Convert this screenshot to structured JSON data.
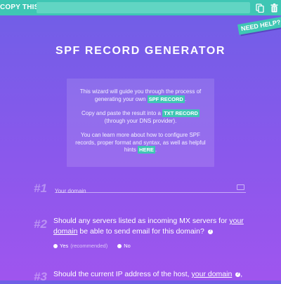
{
  "copy_bar": {
    "label": "COPY THIS:",
    "value": "",
    "copy_icon": "copy-icon",
    "delete_icon": "trash-icon",
    "accent": "#3fc6b4"
  },
  "need_help": "NEED HELP?",
  "title": "SPF RECORD GENERATOR",
  "intro": {
    "line1_pre": "This wizard will guide you through the process of generating your own",
    "line1_badge": "SPF RECORD",
    "line1_post": ".",
    "line2_pre": "Copy and paste the result into a",
    "line2_badge": "TXT RECORD",
    "line2_post": "(through your DNS provider).",
    "line3_pre": "You can learn more about how to configure SPF records, proper format and syntax, as well as helpful hints",
    "line3_badge": "HERE",
    "line3_post": "."
  },
  "step1": {
    "number": "#1",
    "placeholder": "Your domain",
    "value": ""
  },
  "step2": {
    "number": "#2",
    "q_pre": "Should any servers listed as incoming MX servers for",
    "q_link": "your domain",
    "q_post": "be able to send email for this domain?",
    "help": "?",
    "options": {
      "yes": "Yes",
      "yes_note": "(recommended)",
      "no": "No"
    }
  },
  "step3": {
    "number": "#3",
    "q_pre": "Should the current IP address of the host,",
    "q_link": "your domain",
    "help": "?",
    "q_post": ","
  }
}
